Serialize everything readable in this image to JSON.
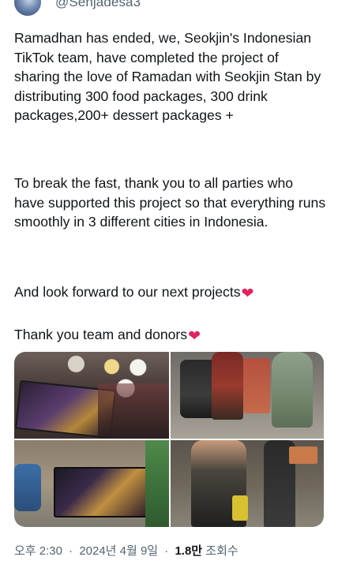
{
  "tweet": {
    "handle": "@Senjadesa3",
    "paragraphs": {
      "p1": "Ramadhan has ended, we, Seokjin's Indonesian TikTok team, have completed the project of sharing the love of Ramadan with Seokjin Stan by distributing 300 food packages, 300 drink packages,200+ dessert packages +",
      "p2": "To break the fast, thank you to all parties who have supported this project so that everything runs smoothly in 3 different cities in Indonesia.",
      "p3": "And look forward to our next projects",
      "p4": "Thank you team and donors"
    },
    "heart_emoji": "❤",
    "media": [
      {
        "name": "photo-1"
      },
      {
        "name": "photo-2"
      },
      {
        "name": "photo-3"
      },
      {
        "name": "photo-4"
      }
    ],
    "meta": {
      "time": "오후 2:30",
      "date": "2024년 4월 9일",
      "views_count": "1.8만",
      "views_label": "조회수",
      "separator": "·"
    }
  },
  "colors": {
    "text_primary": "#0f1419",
    "text_secondary": "#536471",
    "heart": "#e0245e",
    "background": "#ffffff"
  },
  "icons": {
    "avatar": "avatar",
    "heart": "heart-icon"
  }
}
